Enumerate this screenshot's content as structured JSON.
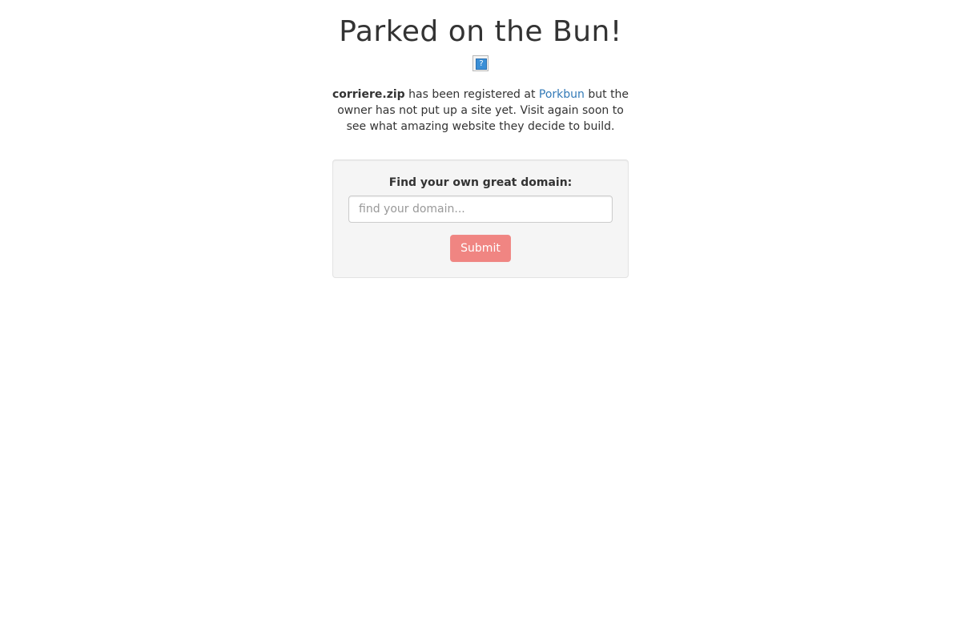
{
  "header": {
    "title": "Parked on the Bun!",
    "logo_icon": "broken-image-icon",
    "logo_glyph": "?"
  },
  "message": {
    "domain": "corriere.zip",
    "text_before_link": " has been registered at ",
    "link_text": "Porkbun",
    "text_after_link": " but the owner has not put up a site yet. Visit again soon to see what amazing website they decide to build."
  },
  "search": {
    "label": "Find your own great domain:",
    "placeholder": "find your domain...",
    "value": "",
    "submit_label": "Submit"
  },
  "colors": {
    "link": "#337ab7",
    "submit_button": "#f08582",
    "panel_background": "#f5f5f5",
    "text": "#333333"
  }
}
